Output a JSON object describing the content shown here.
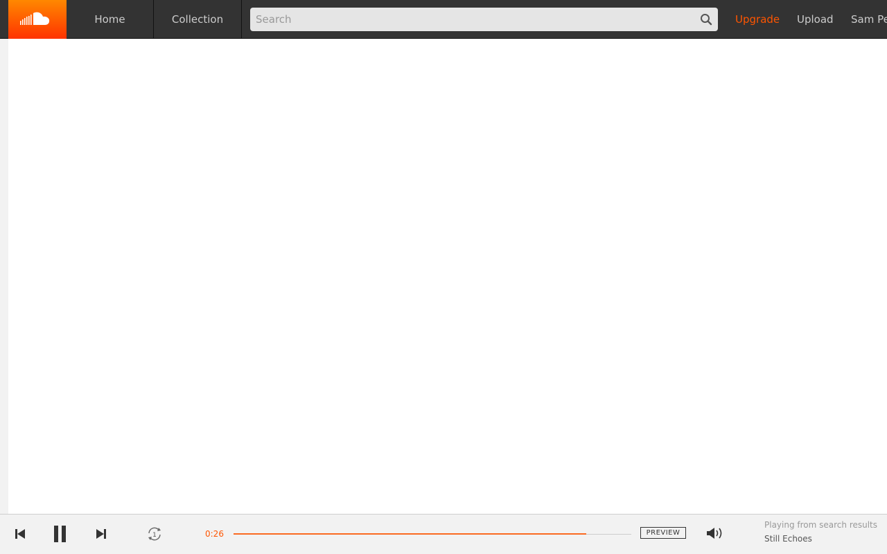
{
  "header": {
    "logo_name": "SoundCloud",
    "nav": [
      {
        "label": "Home"
      },
      {
        "label": "Collection"
      }
    ],
    "search": {
      "placeholder": "Search",
      "value": ""
    },
    "upgrade_label": "Upgrade",
    "upload_label": "Upload",
    "user_name": "Sam Pe"
  },
  "player": {
    "current_time": "0:26",
    "progress_fraction": 0.887,
    "preview_label": "PREVIEW",
    "repeat_mode": "1",
    "context_label": "Playing from search results",
    "track_title": "Still Echoes"
  },
  "colors": {
    "accent": "#ff5500",
    "header_bg": "#333333",
    "player_bg": "#f2f2f2"
  }
}
